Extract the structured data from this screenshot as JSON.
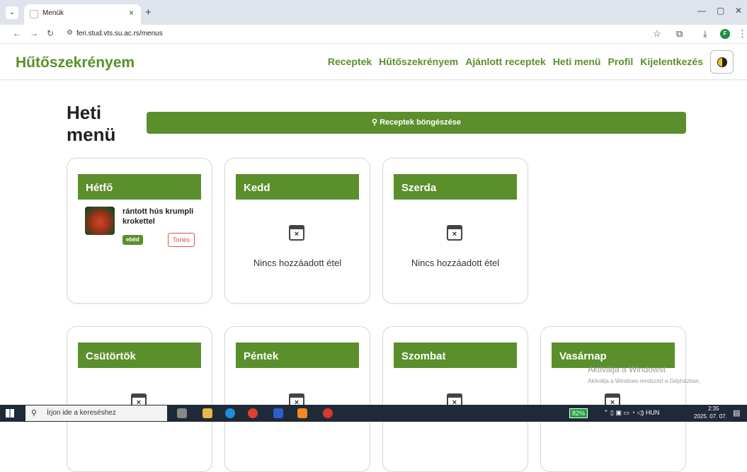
{
  "browser": {
    "tab_title": "Menük",
    "tab_close": "×",
    "new_tab": "+",
    "url": "feri.stud.vts.su.ac.rs/menus",
    "profile_initial": "F"
  },
  "app": {
    "brand": "Hűtőszekrényem",
    "nav": [
      "Receptek",
      "Hűtőszekrényem",
      "Ajánlott receptek",
      "Heti menü",
      "Profil",
      "Kijelentkezés"
    ]
  },
  "page": {
    "title": "Heti menü",
    "browse_button": "Receptek böngészése"
  },
  "days": [
    {
      "name": "Hétfő",
      "meal": {
        "name": "rántott hús krumpli krokettel",
        "badge": "ebéd",
        "delete": "Torlés"
      }
    },
    {
      "name": "Kedd",
      "empty": "Nincs hozzáadott étel"
    },
    {
      "name": "Szerda",
      "empty": "Nincs hozzáadott étel"
    },
    {
      "name": "Csütörtök"
    },
    {
      "name": "Péntek"
    },
    {
      "name": "Szombat"
    },
    {
      "name": "Vasárnap"
    }
  ],
  "watermark": {
    "line1": "Aktiválja a Windowst",
    "line2": "Aktiválja a Windows rendszert a Gépházban."
  },
  "taskbar": {
    "search_placeholder": "Írjon ide a kereséshez",
    "battery": "82%",
    "language": "HUN",
    "time": "2:35",
    "date": "2025. 07. 07."
  }
}
